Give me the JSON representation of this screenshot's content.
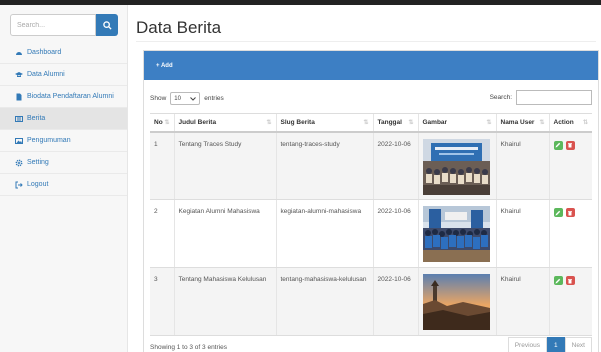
{
  "sidebar": {
    "search_placeholder": "Search...",
    "items": [
      {
        "label": "Dashboard",
        "icon": "dashboard-icon"
      },
      {
        "label": "Data Alumni",
        "icon": "graduation-cap-icon"
      },
      {
        "label": "Biodata Pendaftaran Alumni",
        "icon": "file-icon"
      },
      {
        "label": "Berita",
        "icon": "newspaper-icon",
        "active": true
      },
      {
        "label": "Pengumuman",
        "icon": "image-icon"
      },
      {
        "label": "Setting",
        "icon": "gear-icon"
      },
      {
        "label": "Logout",
        "icon": "logout-icon"
      }
    ]
  },
  "page": {
    "title": "Data Berita"
  },
  "panel": {
    "add_label": "+ Add"
  },
  "controls": {
    "show_label": "Show",
    "entries_value": "10",
    "entries_label": "entries",
    "search_label": "Search:"
  },
  "table": {
    "headers": [
      "No",
      "Judul Berita",
      "Slug Berita",
      "Tanggal",
      "Gambar",
      "Nama User",
      "Action"
    ],
    "rows": [
      {
        "no": "1",
        "judul": "Tentang Traces Study",
        "slug": "tentang-traces-study",
        "tanggal": "2022-10-06",
        "user": "Khairul"
      },
      {
        "no": "2",
        "judul": "Kegiatan Alumni Mahasiswa",
        "slug": "kegiatan-alumni-mahasiswa",
        "tanggal": "2022-10-06",
        "user": "Khairul"
      },
      {
        "no": "3",
        "judul": "Tentang Mahasiswa Kelulusan",
        "slug": "tentang-mahasiswa-kelulusan",
        "tanggal": "2022-10-06",
        "user": "Khairul"
      }
    ]
  },
  "footer": {
    "info": "Showing 1 to 3 of 3 entries",
    "prev": "Previous",
    "page": "1",
    "next": "Next"
  },
  "colors": {
    "primary": "#337ab7",
    "panel_header": "#3d7fc4",
    "edit": "#5cb85c",
    "delete": "#d9534f"
  }
}
